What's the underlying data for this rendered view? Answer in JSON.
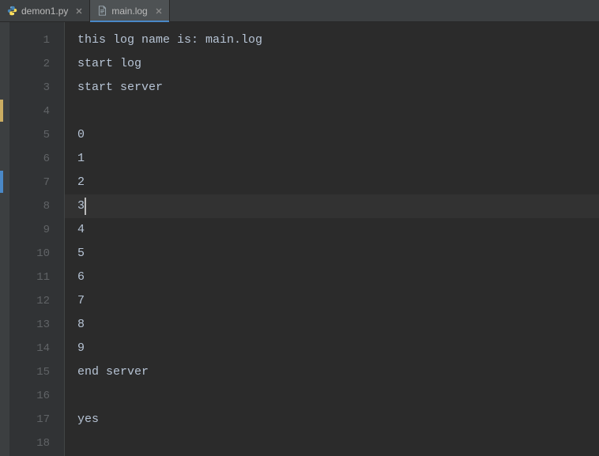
{
  "tabs": [
    {
      "label": "demon1.py",
      "active": false,
      "icon": "python"
    },
    {
      "label": "main.log",
      "active": true,
      "icon": "file"
    }
  ],
  "editor": {
    "lines": [
      "this log name is: main.log",
      "start log",
      "start server",
      "",
      "0",
      "1",
      "2",
      "3",
      "4",
      "5",
      "6",
      "7",
      "8",
      "9",
      "end server",
      "",
      "yes",
      ""
    ],
    "current_line": 8,
    "caret_col": 1,
    "gutter_markers": [
      {
        "line": 4,
        "type": "yellow"
      },
      {
        "line": 7,
        "type": "blue"
      }
    ]
  }
}
